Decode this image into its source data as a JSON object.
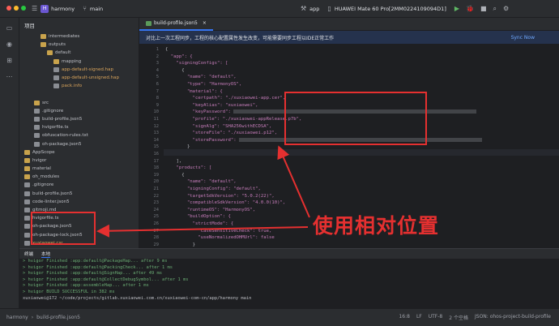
{
  "titlebar": {
    "project_badge": "H",
    "project_name": "harmony",
    "branch": "main",
    "run_config": "app",
    "device": "HUAWEI Mate 60 Pro[2MM0224109094D1]"
  },
  "sidebar": {
    "project_label": "项目"
  },
  "tree": [
    {
      "label": "intermediates",
      "indent": 1,
      "kind": "folder"
    },
    {
      "label": "outputs",
      "indent": 1,
      "kind": "folder"
    },
    {
      "label": "default",
      "indent": 2,
      "kind": "folder"
    },
    {
      "label": "mapping",
      "indent": 3,
      "kind": "folder"
    },
    {
      "label": "app-default-signed.hap",
      "indent": 3,
      "kind": "file"
    },
    {
      "label": "app-default-unsigned.hap",
      "indent": 3,
      "kind": "file"
    },
    {
      "label": "pack.info",
      "indent": 3,
      "kind": "file"
    },
    {
      "label": "",
      "indent": 0,
      "kind": "blank"
    },
    {
      "label": "src",
      "indent": 0,
      "kind": "folder"
    },
    {
      "label": ".gitignore",
      "indent": 0,
      "kind": "file"
    },
    {
      "label": "build-profile.json5",
      "indent": 0,
      "kind": "file"
    },
    {
      "label": "hvigorfile.ts",
      "indent": 0,
      "kind": "file"
    },
    {
      "label": "obfuscation-rules.txt",
      "indent": 0,
      "kind": "file"
    },
    {
      "label": "oh-package.json5",
      "indent": 0,
      "kind": "file"
    },
    {
      "label": "AppScope",
      "indent": -1,
      "kind": "folder"
    },
    {
      "label": "hvigor",
      "indent": -1,
      "kind": "folder"
    },
    {
      "label": "material",
      "indent": -1,
      "kind": "folder"
    },
    {
      "label": "oh_modules",
      "indent": -1,
      "kind": "folder"
    },
    {
      "label": ".gitignore",
      "indent": -1,
      "kind": "file"
    },
    {
      "label": "build-profile.json5",
      "indent": -1,
      "kind": "file"
    },
    {
      "label": "code-linter.json5",
      "indent": -1,
      "kind": "file"
    },
    {
      "label": "gitmoji.md",
      "indent": -1,
      "kind": "file"
    },
    {
      "label": "hvigorfile.ts",
      "indent": -1,
      "kind": "file"
    },
    {
      "label": "oh-package.json5",
      "indent": -1,
      "kind": "file"
    },
    {
      "label": "oh-package-lock.json5",
      "indent": -1,
      "kind": "file"
    },
    {
      "label": "xuxiaowei.csr",
      "indent": -1,
      "kind": "file"
    },
    {
      "label": "xuxiaowei.p12",
      "indent": -1,
      "kind": "file"
    },
    {
      "label": "xuxiaowei-app.cer",
      "indent": -1,
      "kind": "file"
    },
    {
      "label": "xuxiaowei-appRelease.p7b",
      "indent": -1,
      "kind": "file"
    }
  ],
  "editor": {
    "tab_label": "build-profile.json5",
    "notice_text": "对比上一次工程同步，工程的核心配置属性发生改变，可能需要同步工程以IDE正常工作",
    "sync_label": "Sync Now",
    "lines": [
      {
        "n": "1",
        "text": "{"
      },
      {
        "n": "2",
        "text": "  \"app\": {"
      },
      {
        "n": "3",
        "text": "    \"signingConfigs\": ["
      },
      {
        "n": "4",
        "text": "      {"
      },
      {
        "n": "5",
        "text": "        \"name\": \"default\","
      },
      {
        "n": "6",
        "text": "        \"type\": \"HarmonyOS\","
      },
      {
        "n": "7",
        "text": "        \"material\": {"
      },
      {
        "n": "8",
        "text": "          \"certpath\": \"./xuxiaowei-app.cer\","
      },
      {
        "n": "9",
        "text": "          \"keyAlias\": \"xuxiaowei\","
      },
      {
        "n": "10",
        "text": "          \"keyPassword\": "
      },
      {
        "n": "11",
        "text": "          \"profile\": \"./xuxiaowei-appRelease.p7b\","
      },
      {
        "n": "12",
        "text": "          \"signAlg\": \"SHA256withECDSA\","
      },
      {
        "n": "13",
        "text": "          \"storeFile\": \"./xuxiaowei.p12\","
      },
      {
        "n": "14",
        "text": "          \"storePassword\": "
      },
      {
        "n": "15",
        "text": "        }"
      },
      {
        "n": "16",
        "text": "      }"
      },
      {
        "n": "17",
        "text": "    ],"
      },
      {
        "n": "18",
        "text": "    \"products\": ["
      },
      {
        "n": "19",
        "text": "      {"
      },
      {
        "n": "20",
        "text": "        \"name\": \"default\","
      },
      {
        "n": "21",
        "text": "        \"signingConfig\": \"default\","
      },
      {
        "n": "22",
        "text": "        \"targetSdkVersion\": \"5.0.2(22)\","
      },
      {
        "n": "23",
        "text": "        \"compatibleSdkVersion\": \"4.0.0(10)\","
      },
      {
        "n": "24",
        "text": "        \"runtimeOS\": \"HarmonyOS\","
      },
      {
        "n": "25",
        "text": "        \"buildOption\": {"
      },
      {
        "n": "26",
        "text": "          \"strictMode\": {"
      },
      {
        "n": "27",
        "text": "            \"caseSensitiveCheck\": true,"
      },
      {
        "n": "28",
        "text": "            \"useNormalizedOHMUrl\": false"
      },
      {
        "n": "29",
        "text": "          }"
      }
    ]
  },
  "annotation": "使用相对位置",
  "terminal": {
    "tab_label": "终端",
    "tab_local": "本地",
    "lines": [
      "> hvigor Finished :app:default@PackageHap... after 9 ms",
      "> hvigor Finished :app:default@PackingCheck... after 1 ms",
      "> hvigor Finished :app:default@SignHap... after 49 ms",
      "> hvigor Finished :app:default@CollectDebugSymbol... after 1 ms",
      "> hvigor Finished :app:assembleHap... after 1 ms",
      "> hvigor BUILD SUCCESSFUL in 382 ms",
      "xuxiaowei@172 ~/code/projects/gitlab.xuxiaowei.com.cn/xuxiaowei-com-cn/app/harmony  main"
    ]
  },
  "status": {
    "breadcrumb_1": "harmony",
    "breadcrumb_2": "build-profile.json5",
    "position": "16:8",
    "line_ending": "LF",
    "encoding": "UTF-8",
    "indent": "2 个空格",
    "schema": "JSON: ohos-project-build-profile"
  }
}
